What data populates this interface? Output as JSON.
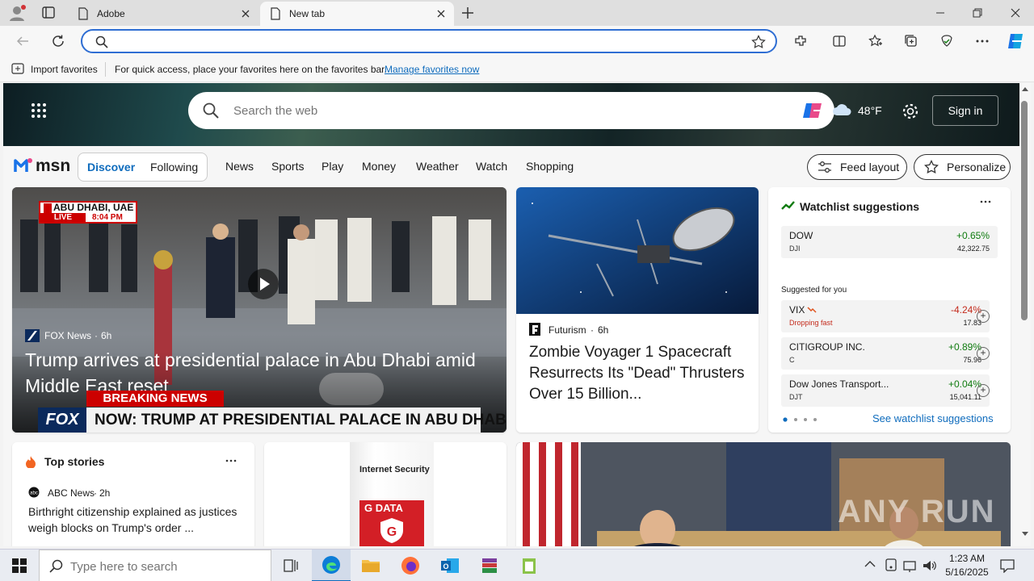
{
  "browser": {
    "tabs": [
      {
        "label": "Adobe",
        "active": false
      },
      {
        "label": "New tab",
        "active": true
      }
    ],
    "address": {
      "value": "",
      "placeholder": ""
    },
    "favorites_bar": {
      "import_label": "Import favorites",
      "message": "For quick access, place your favorites here on the favorites bar.",
      "manage_link": "Manage favorites now"
    }
  },
  "msn": {
    "search_placeholder": "Search the web",
    "weather_temp": "48°F",
    "sign_in": "Sign in",
    "logo_text": "msn",
    "tabs": [
      "Discover",
      "Following"
    ],
    "nav": [
      "News",
      "Sports",
      "Play",
      "Money",
      "Weather",
      "Watch",
      "Shopping"
    ],
    "feed_layout": "Feed layout",
    "personalize": "Personalize",
    "hero": {
      "source": "FOX News",
      "age": "6h",
      "headline": "Trump arrives at presidential palace in Abu Dhabi amid Middle East reset",
      "location_banner": "ABU DHABI, UAE",
      "live_label": "LIVE",
      "live_time": "8:04 PM",
      "breaking": "BREAKING NEWS",
      "ticker": "NOW: TRUMP AT PRESIDENTIAL PALACE IN ABU DHABI",
      "channel": "FOX"
    },
    "article2": {
      "source": "Futurism",
      "age": "6h",
      "headline": "Zombie Voyager 1 Spacecraft Resurrects Its \"Dead\" Thrusters Over 15 Billion..."
    },
    "watchlist": {
      "title": "Watchlist suggestions",
      "main": {
        "name": "DOW",
        "sub": "DJI",
        "change": "+0.65%",
        "value": "42,322.75"
      },
      "suggested_label": "Suggested for you",
      "items": [
        {
          "name": "VIX",
          "sub": "Dropping fast",
          "change": "-4.24%",
          "value": "17.83",
          "color": "#c42b1c"
        },
        {
          "name": "CITIGROUP INC.",
          "sub": "C",
          "change": "+0.89%",
          "value": "75.96",
          "color": "#0f7b0f"
        },
        {
          "name": "Dow Jones Transport...",
          "sub": "DJT",
          "change": "+0.04%",
          "value": "15,041.11",
          "color": "#0f7b0f"
        }
      ],
      "see_link": "See watchlist suggestions"
    },
    "top_stories": {
      "title": "Top stories",
      "source": "ABC News",
      "age": "2h",
      "headline": "Birthright citizenship explained as justices weigh blocks on Trump's order ..."
    },
    "ad": {
      "product": "Internet Security",
      "brand": "G DATA"
    },
    "watermark": "ANY RUN"
  },
  "taskbar": {
    "search_placeholder": "Type here to search",
    "time": "1:23 AM",
    "date": "5/16/2025"
  },
  "colors": {
    "accent": "#0f6cbd",
    "positive": "#0f7b0f",
    "negative": "#c42b1c"
  }
}
